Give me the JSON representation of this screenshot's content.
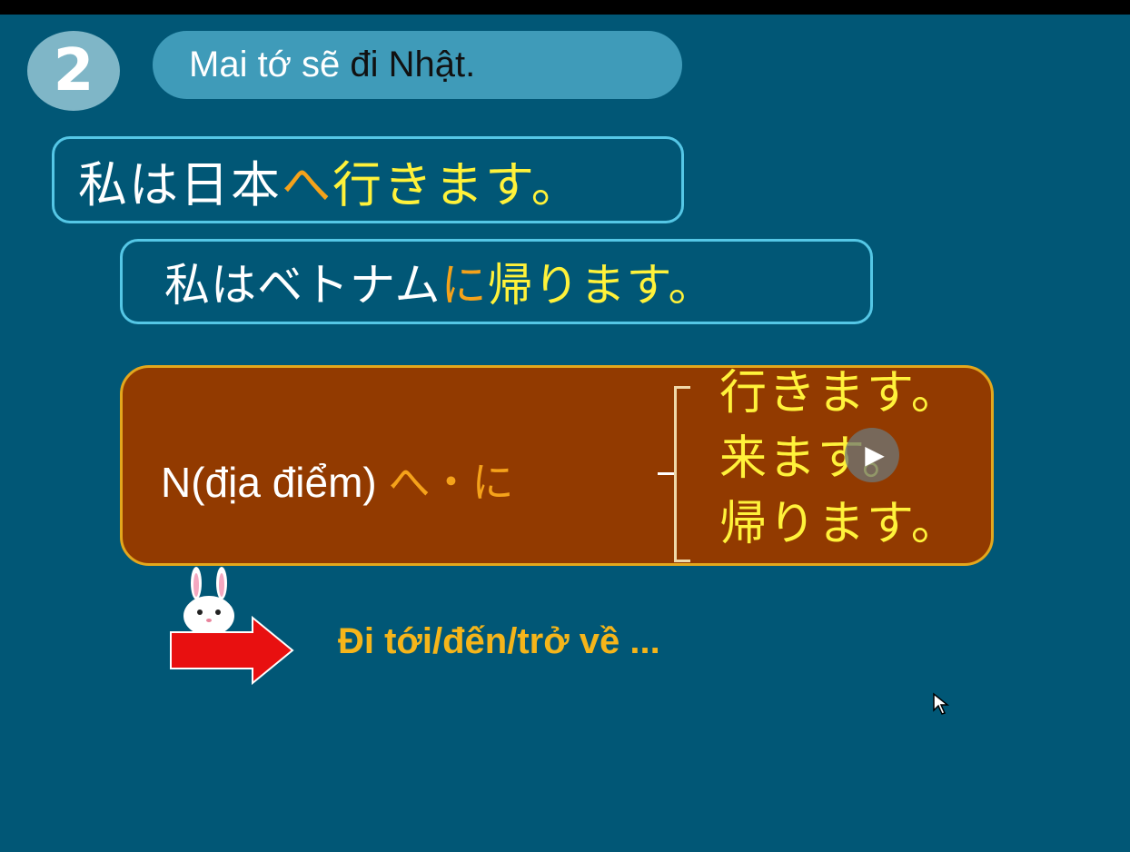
{
  "lesson": {
    "number": "2",
    "title_white": "Mai tớ sẽ ",
    "title_black": "đi Nhật."
  },
  "examples": [
    {
      "subject": "私は日本",
      "particle": "へ",
      "verb": "行きます。"
    },
    {
      "subject": "私はベトナム",
      "particle": "に",
      "verb": "帰ります。"
    }
  ],
  "grammar": {
    "noun_label": "N(địa điểm) ",
    "particles": "へ・に",
    "verbs": [
      "行きます。",
      "来ます。",
      "帰ります。"
    ]
  },
  "meaning": "Đi tới/đến/trở về ...",
  "colors": {
    "background": "#015776",
    "pill": "#3f9bb9",
    "grammar_box": "#923a00",
    "particle": "#f5a21a",
    "verb": "#fff23a"
  },
  "icons": [
    "play-icon",
    "rabbit-icon",
    "arrow-icon",
    "mouse-cursor-icon"
  ]
}
